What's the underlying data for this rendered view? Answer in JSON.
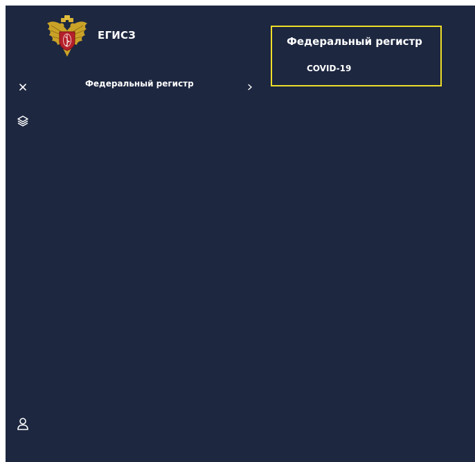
{
  "brand": {
    "title": "ЕГИСЗ"
  },
  "sidebar": {
    "icons": [
      "close-icon",
      "layers-icon",
      "user-icon"
    ]
  },
  "menu": {
    "items": [
      {
        "label": "Федеральный регистр",
        "icon": "chevron-right-icon"
      }
    ]
  },
  "submenu": {
    "title": "Федеральный регистр",
    "items": [
      {
        "label": "COVID-19"
      }
    ],
    "highlight_color": "#f1df28"
  },
  "colors": {
    "background": "#1d2740",
    "text": "#ffffff"
  }
}
